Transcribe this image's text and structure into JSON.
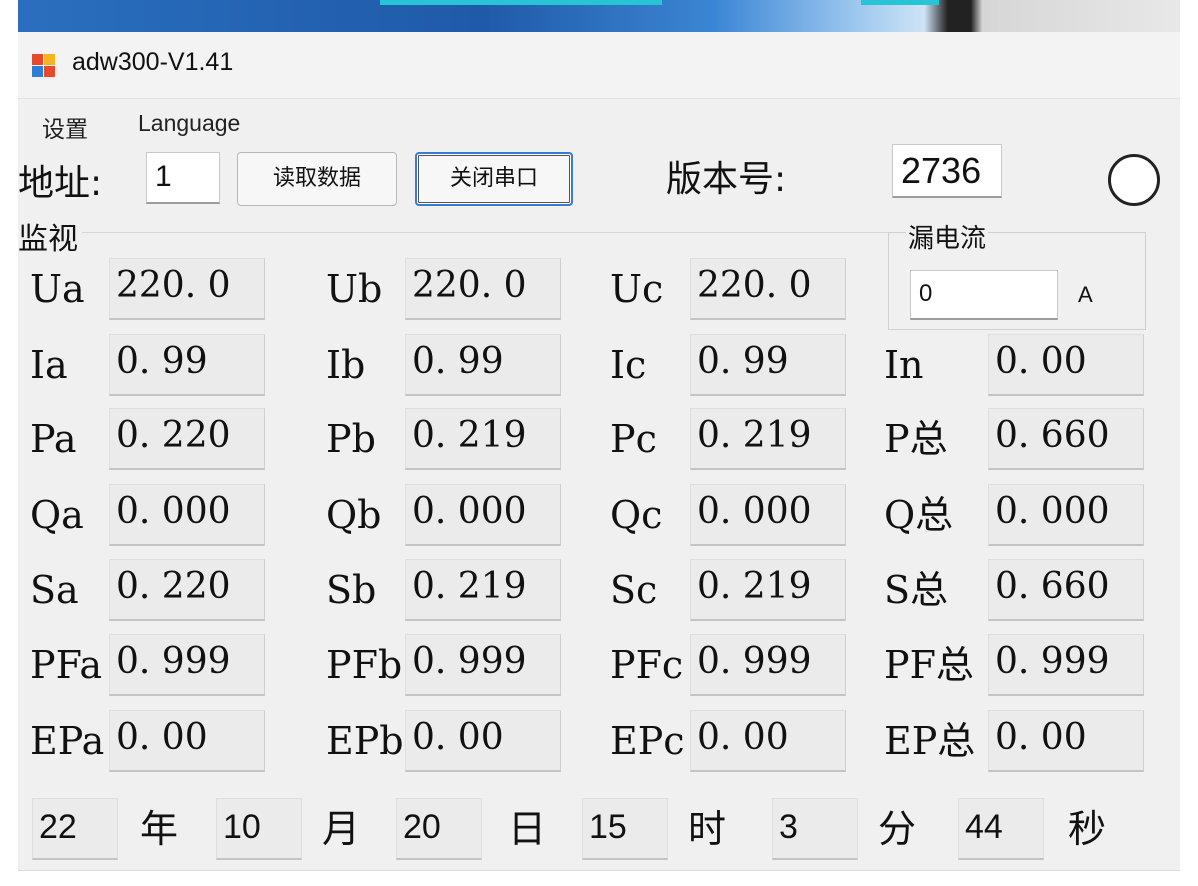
{
  "window": {
    "title": "adw300-V1.41"
  },
  "menu": {
    "settings": "设置",
    "language": "Language"
  },
  "toolbar": {
    "address_label": "地址:",
    "address_value": "1",
    "read_button": "读取数据",
    "close_port_button": "关闭串口",
    "version_label": "版本号:",
    "version_value": "2736"
  },
  "monitor": {
    "title": "监视",
    "rows": [
      [
        {
          "label": "Ua",
          "value": "220. 0"
        },
        {
          "label": "Ub",
          "value": "220. 0"
        },
        {
          "label": "Uc",
          "value": "220. 0"
        }
      ],
      [
        {
          "label": "Ia",
          "value": "0. 99"
        },
        {
          "label": "Ib",
          "value": "0. 99"
        },
        {
          "label": "Ic",
          "value": "0. 99"
        },
        {
          "label": "In",
          "value": "0. 00"
        }
      ],
      [
        {
          "label": "Pa",
          "value": "0. 220"
        },
        {
          "label": "Pb",
          "value": "0. 219"
        },
        {
          "label": "Pc",
          "value": "0. 219"
        },
        {
          "label": "P总",
          "value": "0. 660"
        }
      ],
      [
        {
          "label": "Qa",
          "value": "0. 000"
        },
        {
          "label": "Qb",
          "value": "0. 000"
        },
        {
          "label": "Qc",
          "value": "0. 000"
        },
        {
          "label": "Q总",
          "value": "0. 000"
        }
      ],
      [
        {
          "label": "Sa",
          "value": "0. 220"
        },
        {
          "label": "Sb",
          "value": "0. 219"
        },
        {
          "label": "Sc",
          "value": "0. 219"
        },
        {
          "label": "S总",
          "value": "0. 660"
        }
      ],
      [
        {
          "label": "PFa",
          "value": "0. 999"
        },
        {
          "label": "PFb",
          "value": "0. 999"
        },
        {
          "label": "PFc",
          "value": "0. 999"
        },
        {
          "label": "PF总",
          "value": "0. 999"
        }
      ],
      [
        {
          "label": "EPa",
          "value": "0. 00"
        },
        {
          "label": "EPb",
          "value": "0. 00"
        },
        {
          "label": "EPc",
          "value": "0. 00"
        },
        {
          "label": "EP总",
          "value": "0. 00"
        }
      ]
    ]
  },
  "leakage": {
    "title": "漏电流",
    "value": "0",
    "unit": "A"
  },
  "datetime": [
    {
      "value": "22",
      "unit": "年"
    },
    {
      "value": "10",
      "unit": "月"
    },
    {
      "value": "20",
      "unit": "日"
    },
    {
      "value": "15",
      "unit": "时"
    },
    {
      "value": "3",
      "unit": "分"
    },
    {
      "value": "44",
      "unit": "秒"
    }
  ],
  "colors": {
    "window_bg": "#f0f0f0",
    "focus_border": "#3a7bd5",
    "field_bg": "#ebebeb"
  }
}
